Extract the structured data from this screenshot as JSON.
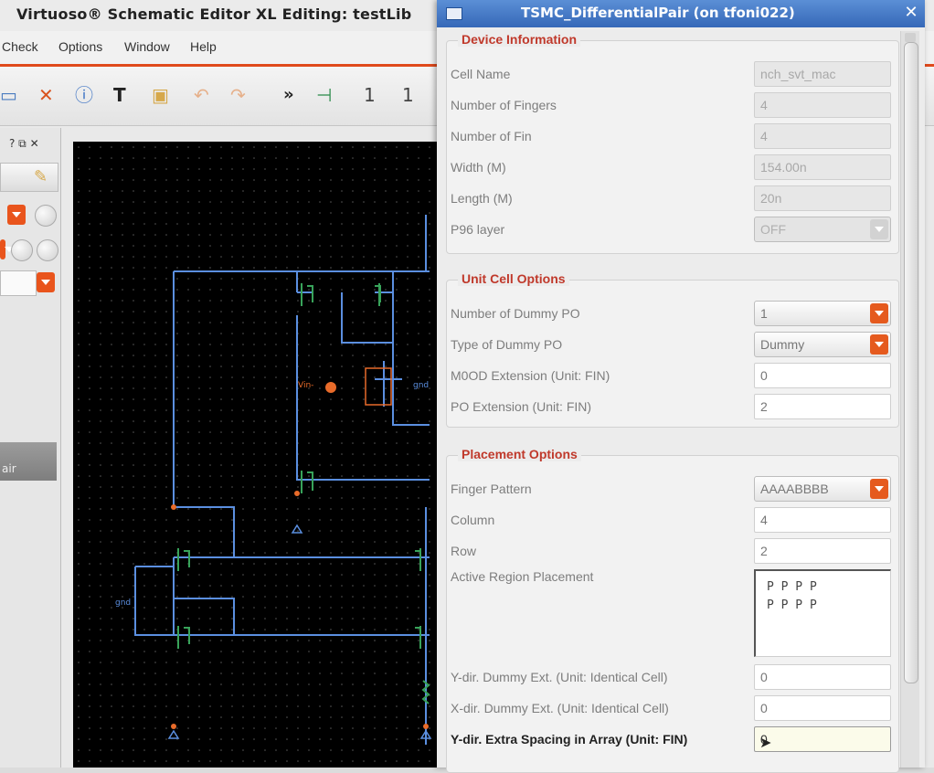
{
  "background_window": {
    "title": "Virtuoso® Schematic Editor XL Editing: testLib",
    "menu": [
      "Check",
      "Options",
      "Window",
      "Help"
    ],
    "panel_controls": "? ⧉ ✕",
    "side_strip_label": "air",
    "toolbar_more": "»"
  },
  "canvas": {
    "labels": {
      "left_net": "gnd",
      "mid_net": "gnd",
      "vin_pin": "Vin-"
    }
  },
  "dialog": {
    "title": "TSMC_DifferentialPair (on tfoni022)",
    "close_label": "✕",
    "device_information": {
      "title": "Device Information",
      "rows": [
        {
          "label": "Cell Name",
          "value": "nch_svt_mac"
        },
        {
          "label": "Number of Fingers",
          "value": "4"
        },
        {
          "label": "Number of Fin",
          "value": "4"
        },
        {
          "label": "Width (M)",
          "value": "154.00n"
        },
        {
          "label": "Length (M)",
          "value": "20n"
        },
        {
          "label": "P96 layer",
          "value": "OFF"
        }
      ]
    },
    "unit_cell_options": {
      "title": "Unit Cell Options",
      "rows": [
        {
          "label": "Number of Dummy PO",
          "value": "1"
        },
        {
          "label": "Type of Dummy PO",
          "value": "Dummy"
        },
        {
          "label": "M0OD Extension (Unit: FIN)",
          "value": "0"
        },
        {
          "label": "PO Extension (Unit: FIN)",
          "value": "2"
        }
      ]
    },
    "placement_options": {
      "title": "Placement Options",
      "finger_pattern": {
        "label": "Finger Pattern",
        "value": "AAAABBBB"
      },
      "column": {
        "label": "Column",
        "value": "4"
      },
      "row": {
        "label": "Row",
        "value": "2"
      },
      "active_region": {
        "label": "Active Region Placement",
        "value": "P P P P\nP P P P"
      },
      "y_dummy": {
        "label": "Y-dir. Dummy Ext. (Unit: Identical Cell)",
        "value": "0"
      },
      "x_dummy": {
        "label": "X-dir. Dummy Ext. (Unit: Identical Cell)",
        "value": "0"
      },
      "y_spacing": {
        "label": "Y-dir. Extra Spacing in Array (Unit: FIN)",
        "value": "0"
      }
    }
  }
}
